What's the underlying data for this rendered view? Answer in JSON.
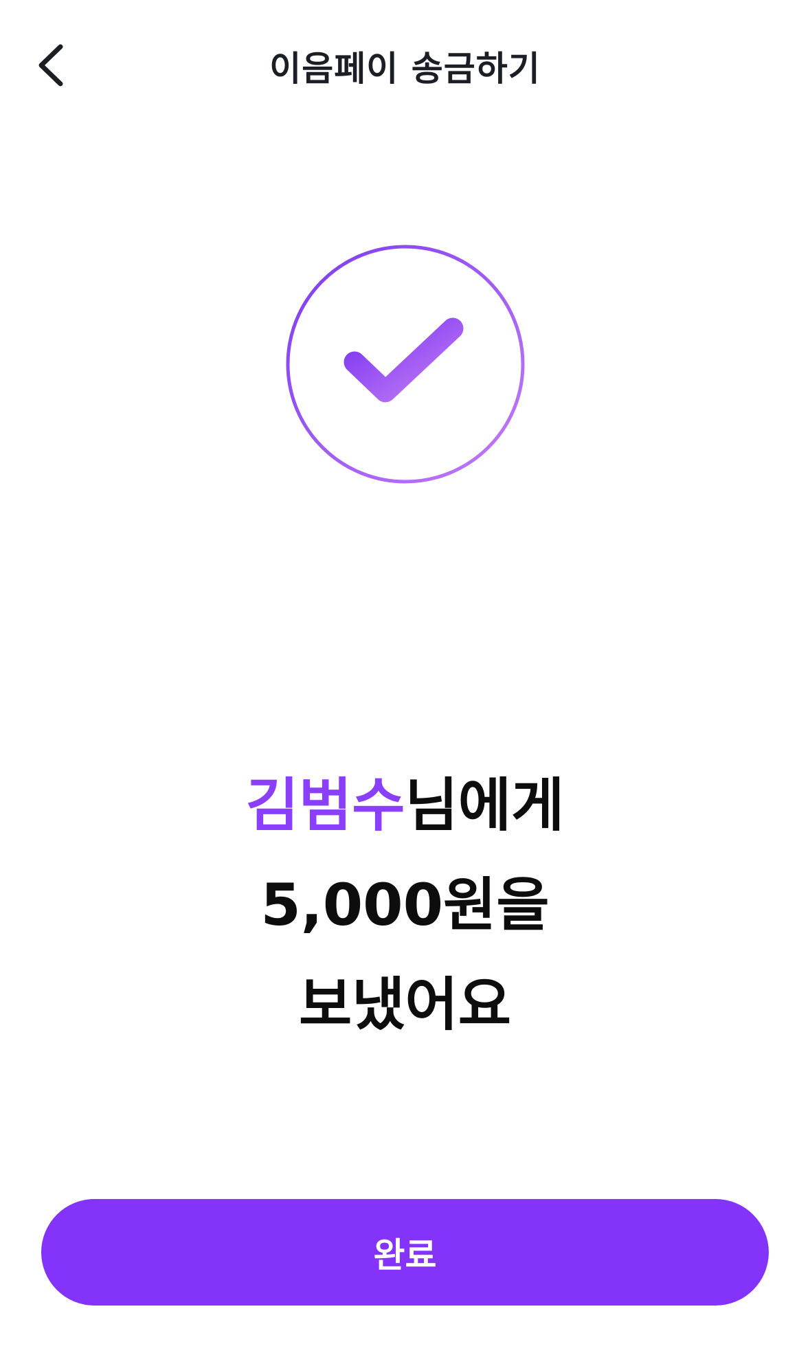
{
  "header": {
    "title": "이음페이 송금하기",
    "back_icon": "chevron-left-icon"
  },
  "status": {
    "icon": "check-circle-icon",
    "accent_colors": [
      "#7b3bf0",
      "#c47cf7"
    ]
  },
  "message": {
    "recipient": "김범수",
    "recipient_suffix": "님에게",
    "amount": "5,000원을",
    "action": "보냈어요",
    "recipient_color": "#8a3ffc"
  },
  "footer": {
    "done_label": "완료",
    "button_color": "#8433fb"
  }
}
